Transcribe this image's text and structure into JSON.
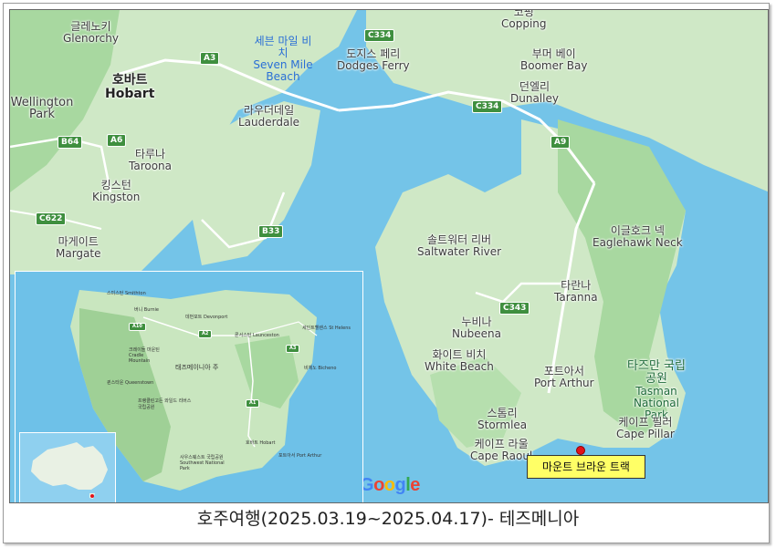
{
  "caption": "호주여행(2025.03.19~2025.04.17)- 테즈메니아",
  "places": {
    "glenorchy_ko": "글레노키",
    "glenorchy_en": "Glenorchy",
    "hobart_ko": "호바트",
    "hobart_en": "Hobart",
    "wellington_park": "Wellington Park",
    "seven_mile_ko": "세븐 마일 비치",
    "seven_mile_en": "Seven Mile Beach",
    "dodges_ko": "도지스 페리",
    "dodges_en": "Dodges Ferry",
    "copping_ko": "코핑",
    "copping_en": "Copping",
    "boomer_ko": "부머 베이",
    "boomer_en": "Boomer Bay",
    "dunalley_ko": "던엘리",
    "dunalley_en": "Dunalley",
    "lauderdale_ko": "라우더데일",
    "lauderdale_en": "Lauderdale",
    "taroona_ko": "타루나",
    "taroona_en": "Taroona",
    "kingston_ko": "킹스턴",
    "kingston_en": "Kingston",
    "margate_ko": "마게이트",
    "margate_en": "Margate",
    "saltwater_ko": "솔트워터 리버",
    "saltwater_en": "Saltwater River",
    "eaglehawk_ko": "이글호크 넥",
    "eaglehawk_en": "Eaglehawk Neck",
    "taranna_ko": "타란나",
    "taranna_en": "Taranna",
    "nubeena_ko": "누비나",
    "nubeena_en": "Nubeena",
    "whitebeach_ko": "화이트 비치",
    "whitebeach_en": "White Beach",
    "portarthur_ko": "포트아서",
    "portarthur_en": "Port Arthur",
    "tasman_np_ko": "타즈만 국립공원",
    "tasman_np_en": "Tasman National Park",
    "stormlea_ko": "스톰리",
    "stormlea_en": "Stormlea",
    "caperaoul_ko": "케이프 라울",
    "caperaoul_en": "Cape Raoul",
    "capepillar_ko": "케이프 필러",
    "capepillar_en": "Cape Pillar"
  },
  "roads": {
    "a3": "A3",
    "c334a": "C334",
    "c334b": "C334",
    "b64": "B64",
    "a6": "A6",
    "a9": "A9",
    "c622": "C622",
    "b33": "B33",
    "c343": "C343"
  },
  "trek_label": "마운트 브라운 트랙",
  "google_logo": [
    "G",
    "o",
    "o",
    "g",
    "l",
    "e"
  ],
  "colors": {
    "water": "#74c4e8",
    "land": "#cfe8c6",
    "forest": "#a8d8a0",
    "road": "#ffffff",
    "trek_box": "#ffff66",
    "trek_dot": "#e3101a"
  },
  "inset": {
    "places": {
      "smithton": "스미스턴 Smithton",
      "burnie": "버니 Burnie",
      "devonport": "데번포트 Devonport",
      "launceston": "론서스턴 Launceston",
      "sthelens": "세인트헬렌스 St Helens",
      "cradle": "크레이들 마운틴 Cradle Mountain",
      "bicheno": "비체노 Bicheno",
      "tasmania": "태즈메이니아 주",
      "queenstown": "퀸스타운 Queenstown",
      "franklin": "프랭클린고든 와일드 리버스 국립공원",
      "hobart": "호바트 Hobart",
      "southwest": "사우스웨스트 국립공원 Southwest National Park",
      "portarthur": "포트아서 Port Arthur"
    },
    "roads": {
      "a10": "A10",
      "a2": "A2",
      "a1": "A1",
      "a3": "A3"
    }
  }
}
